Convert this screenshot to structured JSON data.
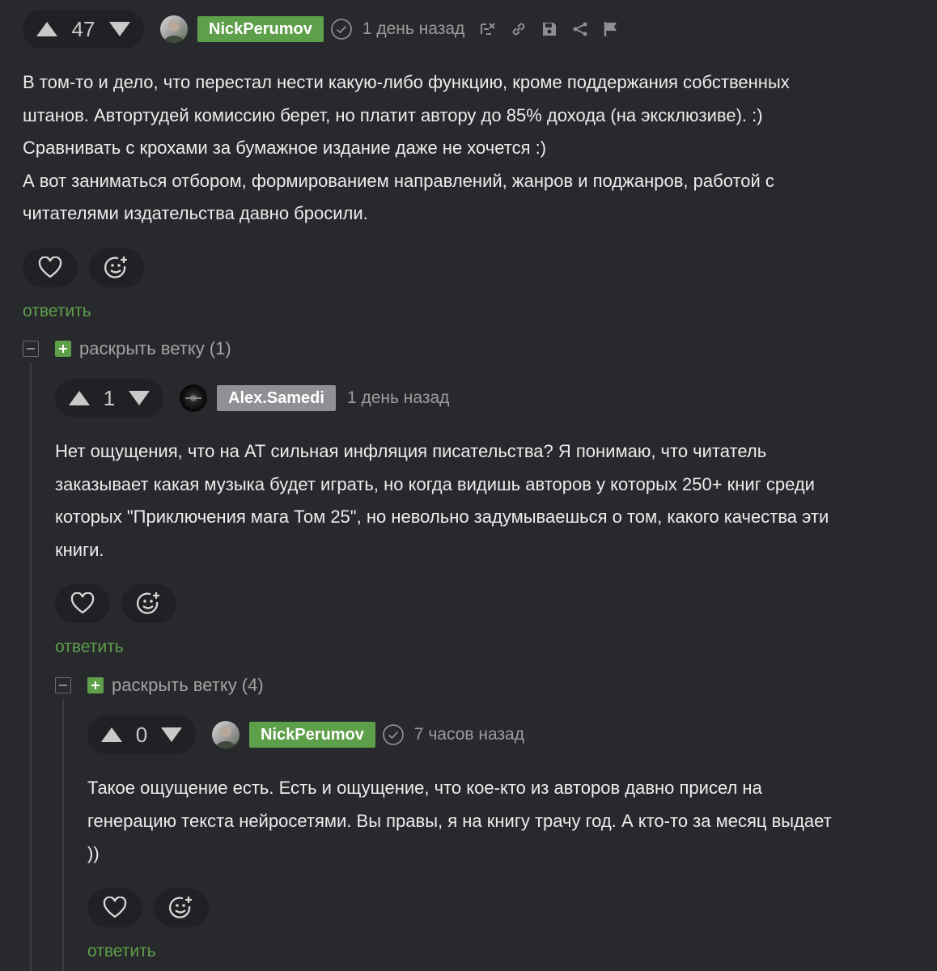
{
  "comments": [
    {
      "score": "47",
      "username": "NickPerumov",
      "time": "1 день назад",
      "lines": [
        "В том-то и дело, что перестал нести какую-либо функцию, кроме поддержания собственных",
        "штанов. Автортудей комиссию берет, но платит автору до 85% дохода (на эксклюзиве). :)",
        "Сравнивать с крохами за бумажное издание даже не хочется :)",
        "А вот заниматься отбором, формированием направлений, жанров и поджанров, работой с",
        "читателями издательства давно бросили."
      ],
      "reply": "ответить"
    },
    {
      "score": "1",
      "username": "Alex.Samedi",
      "time": "1 день назад",
      "lines": [
        "Нет ощущения, что на АТ сильная инфляция писательства? Я понимаю, что читатель",
        "заказывает какая музыка будет играть, но когда видишь авторов у которых 250+ книг среди",
        "которых \"Приключения мага Том 25\", но невольно задумываешься о том, какого качества эти",
        "книги."
      ],
      "reply": "ответить"
    },
    {
      "score": "0",
      "username": "NickPerumov",
      "time": "7 часов назад",
      "lines": [
        "Такое ощущение есть. Есть и ощущение, что кое-кто из авторов давно присел на",
        "генерацию текста нейросетями. Вы правы, я на книгу трачу год. А кто-то за месяц выдает",
        "))"
      ],
      "reply": "ответить"
    }
  ],
  "branches": [
    {
      "label": "раскрыть ветку (1)"
    },
    {
      "label": "раскрыть ветку (4)"
    }
  ],
  "colors": {
    "background": "#28292d",
    "accent": "#5e9f4a",
    "pill": "#202124",
    "muted": "#9c9c9c"
  }
}
